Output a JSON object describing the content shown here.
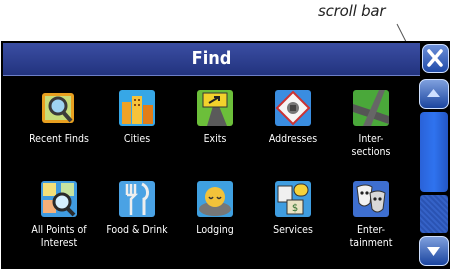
{
  "callout": {
    "label": "scroll bar"
  },
  "window": {
    "title": "Find"
  },
  "categories": [
    {
      "label": "Recent Finds",
      "icon": "recent-finds-icon"
    },
    {
      "label": "Cities",
      "icon": "cities-icon"
    },
    {
      "label": "Exits",
      "icon": "exits-icon"
    },
    {
      "label": "Addresses",
      "icon": "addresses-icon"
    },
    {
      "label": "Inter-\nsections",
      "icon": "intersections-icon"
    },
    {
      "label": "All Points of\nInterest",
      "icon": "points-of-interest-icon"
    },
    {
      "label": "Food & Drink",
      "icon": "food-drink-icon"
    },
    {
      "label": "Lodging",
      "icon": "lodging-icon"
    },
    {
      "label": "Services",
      "icon": "services-icon"
    },
    {
      "label": "Enter-\ntainment",
      "icon": "entertainment-icon"
    }
  ],
  "scroll": {
    "position_fraction": 0.0,
    "visible_fraction": 0.65
  }
}
